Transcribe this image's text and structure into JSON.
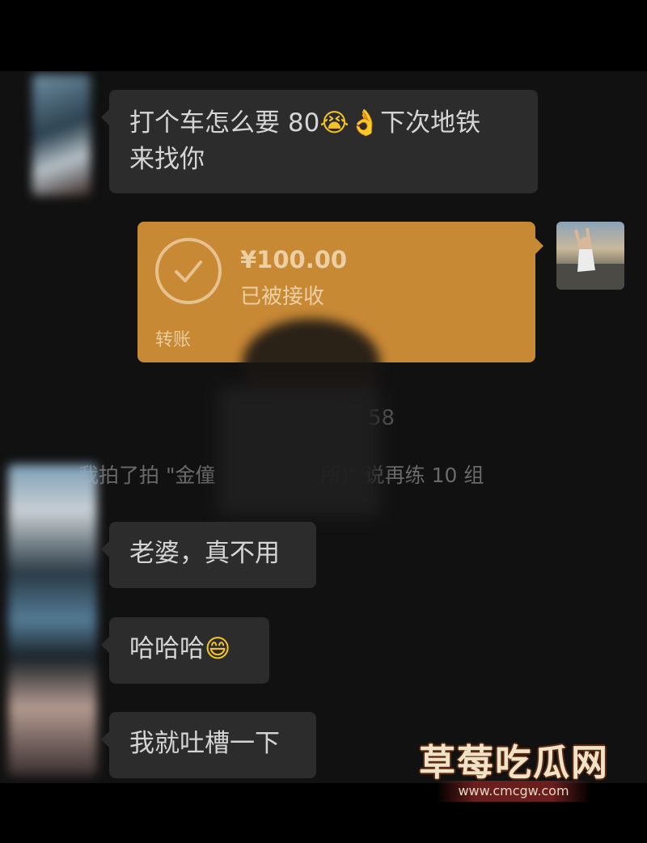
{
  "messages": [
    {
      "line1_pre": "打个车怎么要 80",
      "emoji1": "😭",
      "emoji2": "👌",
      "line1_post": "下次地铁",
      "line2": "来找你"
    },
    {
      "text": "老婆，真不用"
    },
    {
      "text": "哈哈哈",
      "emoji": "😄"
    },
    {
      "text": "我就吐槽一下"
    }
  ],
  "transfer": {
    "amount": "¥100.00",
    "status": "已被接收",
    "label": "转账",
    "color": "#c88935"
  },
  "timestamp_fragment": "58",
  "system_message": {
    "pre": "我拍了拍 \"金僮",
    "post": "所)\" 说再练 10 组"
  },
  "watermark": {
    "title": "草莓吃瓜网",
    "url": "www.cmcgw.com"
  }
}
